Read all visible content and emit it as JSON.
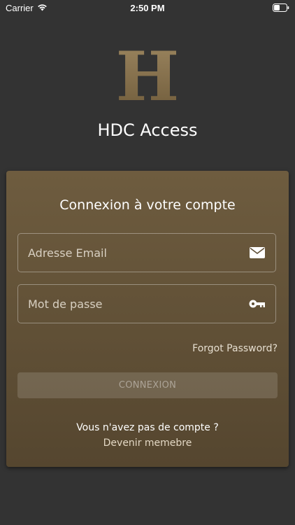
{
  "status_bar": {
    "carrier": "Carrier",
    "time": "2:50 PM",
    "wifi_icon": "wifi-icon",
    "battery_icon": "battery-icon"
  },
  "logo": {
    "letter": "H",
    "color": "#8a7450"
  },
  "app": {
    "title": "HDC Access"
  },
  "login_card": {
    "title": "Connexion à votre compte",
    "email": {
      "placeholder": "Adresse Email",
      "value": "",
      "icon": "envelope-icon"
    },
    "password": {
      "placeholder": "Mot de passe",
      "value": "",
      "icon": "key-icon"
    },
    "forgot_password": "Forgot Password?",
    "submit_label": "CONNEXION",
    "no_account_text": "Vous n'avez pas de compte ?",
    "register_link": "Devenir memebre"
  },
  "colors": {
    "background": "#333333",
    "card_gradient_top": "#6e5c3f",
    "card_gradient_bottom": "#55462f",
    "accent_gold": "#8a7450"
  }
}
